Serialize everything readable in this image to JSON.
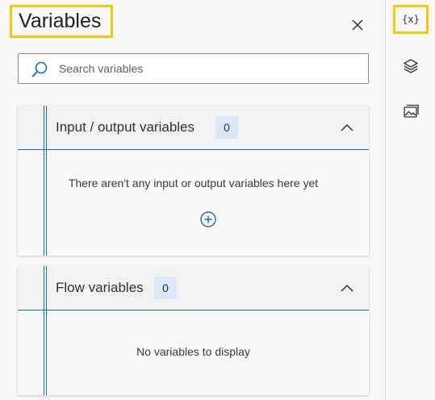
{
  "panel": {
    "title": "Variables",
    "search": {
      "placeholder": "Search variables",
      "value": ""
    }
  },
  "sections": {
    "io": {
      "label": "Input / output variables",
      "count": "0",
      "empty_text": "There aren't any input or output variables here yet"
    },
    "flow": {
      "label": "Flow variables",
      "count": "0",
      "empty_text": "No variables to display"
    }
  },
  "rail": {
    "items": [
      {
        "icon": "variables-icon",
        "label": "{x}",
        "active": true
      },
      {
        "icon": "layers-icon",
        "active": false
      },
      {
        "icon": "images-icon",
        "active": false
      }
    ]
  },
  "colors": {
    "accent": "#0f6cbd",
    "highlight": "#f2c811",
    "badge_bg": "#dbe8f8",
    "header_bg": "#f3f2f1"
  }
}
